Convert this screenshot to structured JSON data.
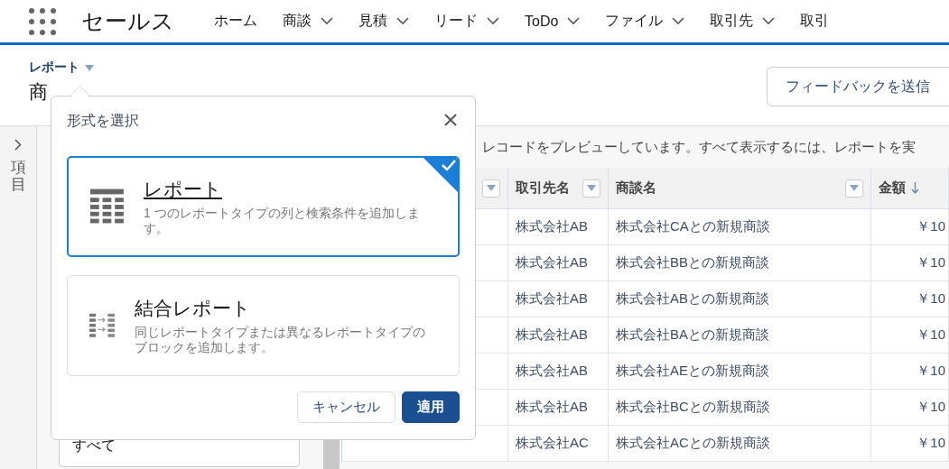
{
  "app_name": "セールス",
  "nav_items": [
    {
      "label": "ホーム",
      "has_menu": false
    },
    {
      "label": "商談",
      "has_menu": true
    },
    {
      "label": "見積",
      "has_menu": true
    },
    {
      "label": "リード",
      "has_menu": true
    },
    {
      "label": "ToDo",
      "has_menu": true
    },
    {
      "label": "ファイル",
      "has_menu": true
    },
    {
      "label": "取引先",
      "has_menu": true
    },
    {
      "label": "取引",
      "has_menu": false
    }
  ],
  "header": {
    "breadcrumb": "レポート",
    "title": "商",
    "feedback_button": "フィードバックを送信"
  },
  "sidebar": {
    "label": "項目"
  },
  "filter_field": {
    "value": "すべて"
  },
  "preview_notice": "レコードをプレビューしています。すべて表示するには、レポートを実",
  "table": {
    "columns": [
      {
        "filter": true
      },
      {
        "label": "取引先名",
        "filter": true
      },
      {
        "label": "商談名",
        "filter": true
      },
      {
        "label": "金額",
        "sorted": true
      }
    ],
    "rows": [
      [
        "",
        "株式会社AB",
        "株式会社CAとの新規商談",
        "￥10"
      ],
      [
        "",
        "株式会社AB",
        "株式会社BBとの新規商談",
        "￥10"
      ],
      [
        "",
        "株式会社AB",
        "株式会社ABとの新規商談",
        "￥10"
      ],
      [
        "",
        "株式会社AB",
        "株式会社BAとの新規商談",
        "￥10"
      ],
      [
        "",
        "株式会社AB",
        "株式会社AEとの新規商談",
        "￥10"
      ],
      [
        "",
        "株式会社AB",
        "株式会社BCとの新規商談",
        "￥10"
      ],
      [
        "",
        "株式会社AC",
        "株式会社ACとの新規商談",
        "￥10"
      ]
    ]
  },
  "dialog": {
    "title": "形式を選択",
    "options": [
      {
        "kind": "single",
        "title": "レポート",
        "description": "1 つのレポートタイプの列と検索条件を追加します。",
        "selected": true
      },
      {
        "kind": "joined",
        "title": "結合レポート",
        "description": "同じレポートタイプまたは異なるレポートタイプのブロックを追加します。",
        "selected": false
      }
    ],
    "buttons": [
      {
        "label": "キャンセル",
        "primary": false
      },
      {
        "label": "適用",
        "primary": true
      }
    ]
  }
}
